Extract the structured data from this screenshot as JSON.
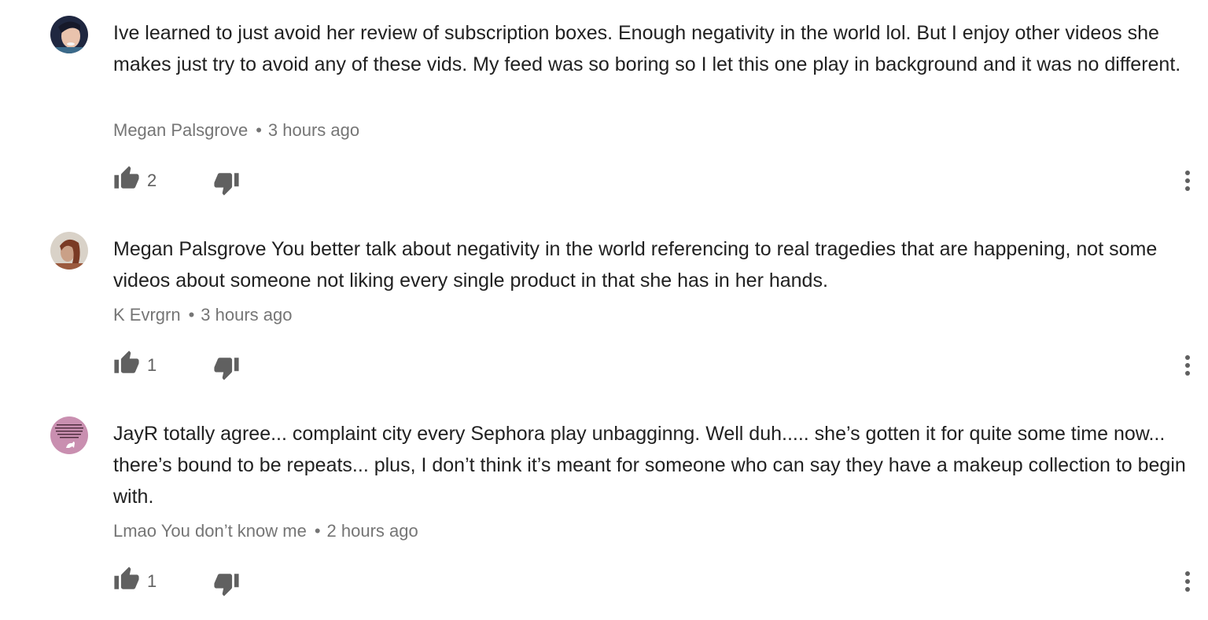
{
  "comments": [
    {
      "text": "Ive learned to just avoid her review of subscription boxes. Enough negativity in the world lol. But I enjoy other videos she makes just try to avoid any of these vids. My feed was so boring so I let this one play in background and it was no different.",
      "author": "Megan Palsgrove",
      "time": "3 hours ago",
      "likes": "2",
      "avatar_color": "#2b3450"
    },
    {
      "text": "Megan Palsgrove You better talk about negativity in the world referencing to real tragedies that are happening, not some videos about someone not liking every single product in that she has in her hands.",
      "author": "K Evrgrn",
      "time": "3 hours ago",
      "likes": "1",
      "avatar_color": "#8a5a44"
    },
    {
      "text": "JayR totally agree... complaint city every Sephora play unbagginng. Well duh..... she’s gotten it for quite some time now... there’s bound to be repeats... plus, I don’t think it’s meant for someone who can say they have a makeup collection to begin with.",
      "author": "Lmao You don’t know me",
      "time": "2 hours ago",
      "likes": "1",
      "avatar_color": "#c98fb0"
    }
  ],
  "separator": "•",
  "icons": {
    "like": "thumbs-up-icon",
    "dislike": "thumbs-down-icon",
    "more": "vertical-dots-icon"
  },
  "colors": {
    "text": "#212121",
    "meta": "#757575",
    "icon": "#606060"
  }
}
